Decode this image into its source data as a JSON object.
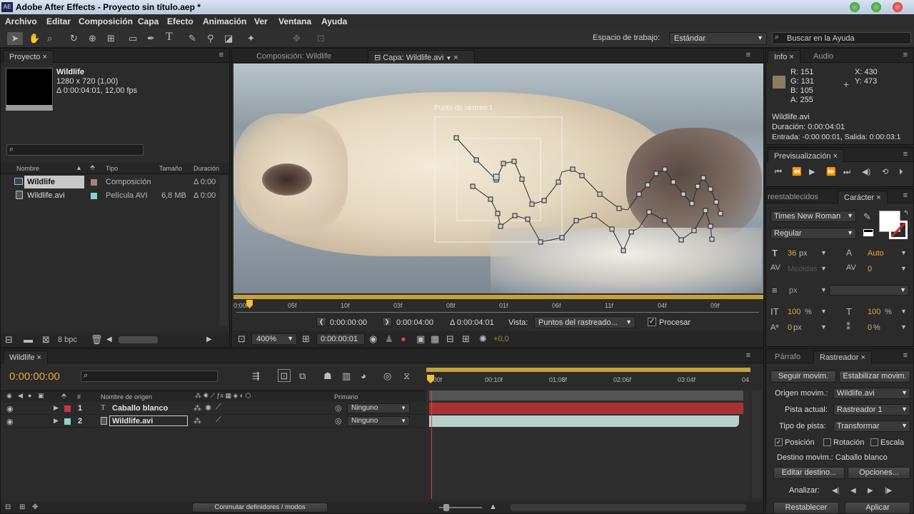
{
  "title_bar": {
    "app_icon": "AE",
    "title": "Adobe After Effects - Proyecto sin título.aep *"
  },
  "menu": [
    "Archivo",
    "Editar",
    "Composición",
    "Capa",
    "Efecto",
    "Animación",
    "Ver",
    "Ventana",
    "Ayuda"
  ],
  "toolbar": {
    "workspace_label": "Espacio de trabajo:",
    "workspace_value": "Estándar",
    "help_placeholder": "Buscar en la Ayuda"
  },
  "project": {
    "tab": "Proyecto",
    "item_name": "Wildlife",
    "item_res": "1280 x 720 (1,00)",
    "item_dur": "Δ 0:00:04:01, 12,00 fps",
    "columns": [
      "Nombre",
      "Tipo",
      "Tamaño",
      "Duración"
    ],
    "rows": [
      {
        "name": "Wildlife",
        "type": "Composición",
        "size": "",
        "dur": "Δ 0:00"
      },
      {
        "name": "Wildlife.avi",
        "type": "Película AVI",
        "size": "6,8 MB",
        "dur": "Δ 0:00"
      }
    ],
    "bpc": "8 bpc"
  },
  "viewer": {
    "tab_comp": "Composición: Wildlife",
    "tab_layer": "Capa: Wildlife.avi",
    "track_label": "Punto de rastreo 1",
    "ruler": [
      "0:00f",
      "05f",
      "10f",
      "03f",
      "08f",
      "01f",
      "06f",
      "11f",
      "04f",
      "09f"
    ],
    "time_in": "0:00:00:00",
    "time_out": "0:00:04:00",
    "time_dur": "Δ 0:00:04:01",
    "view_label": "Vista:",
    "view_value": "Puntos del rastreado...",
    "process_label": "Procesar",
    "zoom": "400%",
    "current_time": "0:00:00:01",
    "exposure": "+0,0"
  },
  "info": {
    "tab_info": "Info",
    "tab_audio": "Audio",
    "r": "R:  151",
    "g": "G:  131",
    "b": "B:  105",
    "a": "A:  255",
    "x": "X:  430",
    "y": "Y:  473",
    "swatch": "#8c7c64",
    "file": "Wildlife.avi",
    "duration": "Duración: 0:00:04:01",
    "entry": "Entrada: -0:00:00:01, Salida: 0:00:03:1"
  },
  "preview": {
    "tab": "Previsualización"
  },
  "character": {
    "tab_presets": "reestablecidos",
    "tab_char": "Carácter",
    "font": "Times New Roman",
    "style": "Regular",
    "size": "36",
    "size_unit": "px",
    "leading": "Auto",
    "kerning": "Medidas",
    "tracking": "0",
    "stroke_unit": "px",
    "vscale": "100",
    "hscale": "100",
    "pct": "%",
    "baseline": "0",
    "baseline_unit": "px",
    "tsume": "0"
  },
  "timeline": {
    "tab": "Wildlife",
    "time": "0:00:00:00",
    "ruler": [
      "0:00f",
      "00:10f",
      "01:08f",
      "02:06f",
      "03:04f",
      "04"
    ],
    "col_source": "Nombre de origen",
    "col_parent": "Primario",
    "layers": [
      {
        "num": "1",
        "name": "Caballo blanco",
        "parent": "Ninguno",
        "color": "#c43a3a"
      },
      {
        "num": "2",
        "name": "Wildlife.avi",
        "parent": "Ninguno",
        "color": "#8fd0c8"
      }
    ],
    "toggle_label": "Conmutar definidores / modos"
  },
  "tracker": {
    "tab_para": "Párrafo",
    "tab_tracker": "Rastreador",
    "btn_track": "Seguir movim.",
    "btn_stabilize": "Estabilizar movim.",
    "source_label": "Origen movim.:",
    "source_value": "Wildlife.avi",
    "track_label": "Pista actual:",
    "track_value": "Rastreador 1",
    "type_label": "Tipo de pista:",
    "type_value": "Transformar",
    "pos": "Posición",
    "rot": "Rotación",
    "scale": "Escala",
    "target": "Destino movim.: Caballo blanco",
    "edit_target": "Editar destino...",
    "options": "Opciones...",
    "analyze": "Analizar:",
    "reset": "Restablecer",
    "apply": "Aplicar"
  }
}
